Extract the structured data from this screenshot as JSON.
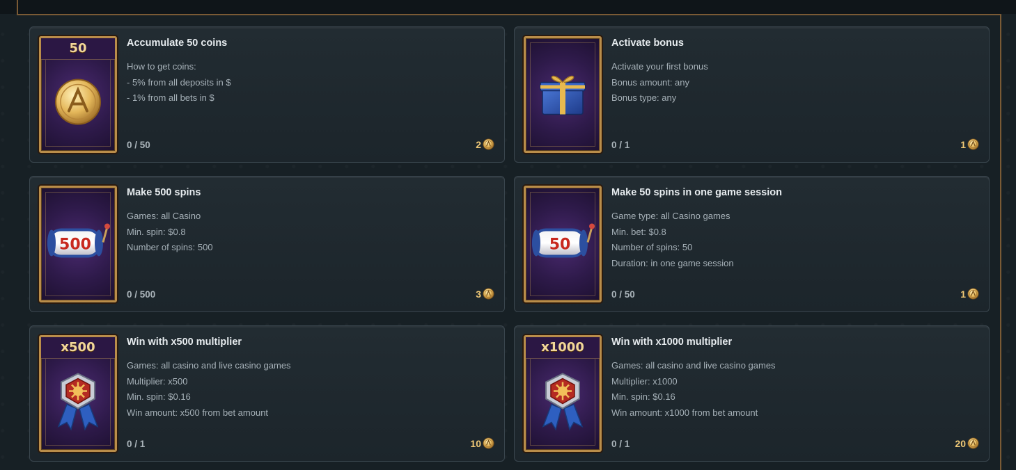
{
  "quests": [
    {
      "frame_label": "",
      "art_icon": "gold-coin-icon",
      "title": "Accumulate 50 coins",
      "lines": [
        "How to get coins:",
        "- 5% from all deposits in $",
        "- 1% from all bets in $"
      ],
      "progress": "0 / 50",
      "reward": "2",
      "frame_badge": "50"
    },
    {
      "frame_label": "",
      "art_icon": "gift-box-icon",
      "title": "Activate bonus",
      "lines": [
        "Activate your first bonus",
        "Bonus amount: any",
        "Bonus type: any"
      ],
      "progress": "0 / 1",
      "reward": "1",
      "frame_badge": ""
    },
    {
      "frame_label": "",
      "art_icon": "slot-reel-500-icon",
      "art_text": "500",
      "title": "Make 500 spins",
      "lines": [
        "Games: all Casino",
        "Min. spin: $0.8",
        "Number of spins: 500"
      ],
      "progress": "0 / 500",
      "reward": "3",
      "frame_badge": ""
    },
    {
      "frame_label": "",
      "art_icon": "slot-reel-50-icon",
      "art_text": "50",
      "title": "Make 50 spins in one game session",
      "lines": [
        "Game type: all Casino games",
        "Min. bet: $0.8",
        "Number of spins: 50",
        "Duration: in one game session"
      ],
      "progress": "0 / 50",
      "reward": "1",
      "frame_badge": ""
    },
    {
      "frame_label": "",
      "art_icon": "medal-ribbon-icon",
      "title": "Win with x500 multiplier",
      "lines": [
        "Games: all casino and live casino games",
        "Multiplier: x500",
        "Min. spin: $0.16",
        "Win amount: x500 from bet amount"
      ],
      "progress": "0 / 1",
      "reward": "10",
      "frame_badge": "x500"
    },
    {
      "frame_label": "",
      "art_icon": "medal-ribbon-icon",
      "title": "Win with x1000 multiplier",
      "lines": [
        "Games: all casino and live casino games",
        "Multiplier: x1000",
        "Min. spin: $0.16",
        "Win amount: x1000 from bet amount"
      ],
      "progress": "0 / 1",
      "reward": "20",
      "frame_badge": "x1000"
    }
  ],
  "reward_icon": "coin-icon",
  "colors": {
    "accent_gold": "#f0c977",
    "frame_gold": "#b98d4a",
    "card_bg": "#222c32",
    "page_bg": "#172025"
  }
}
